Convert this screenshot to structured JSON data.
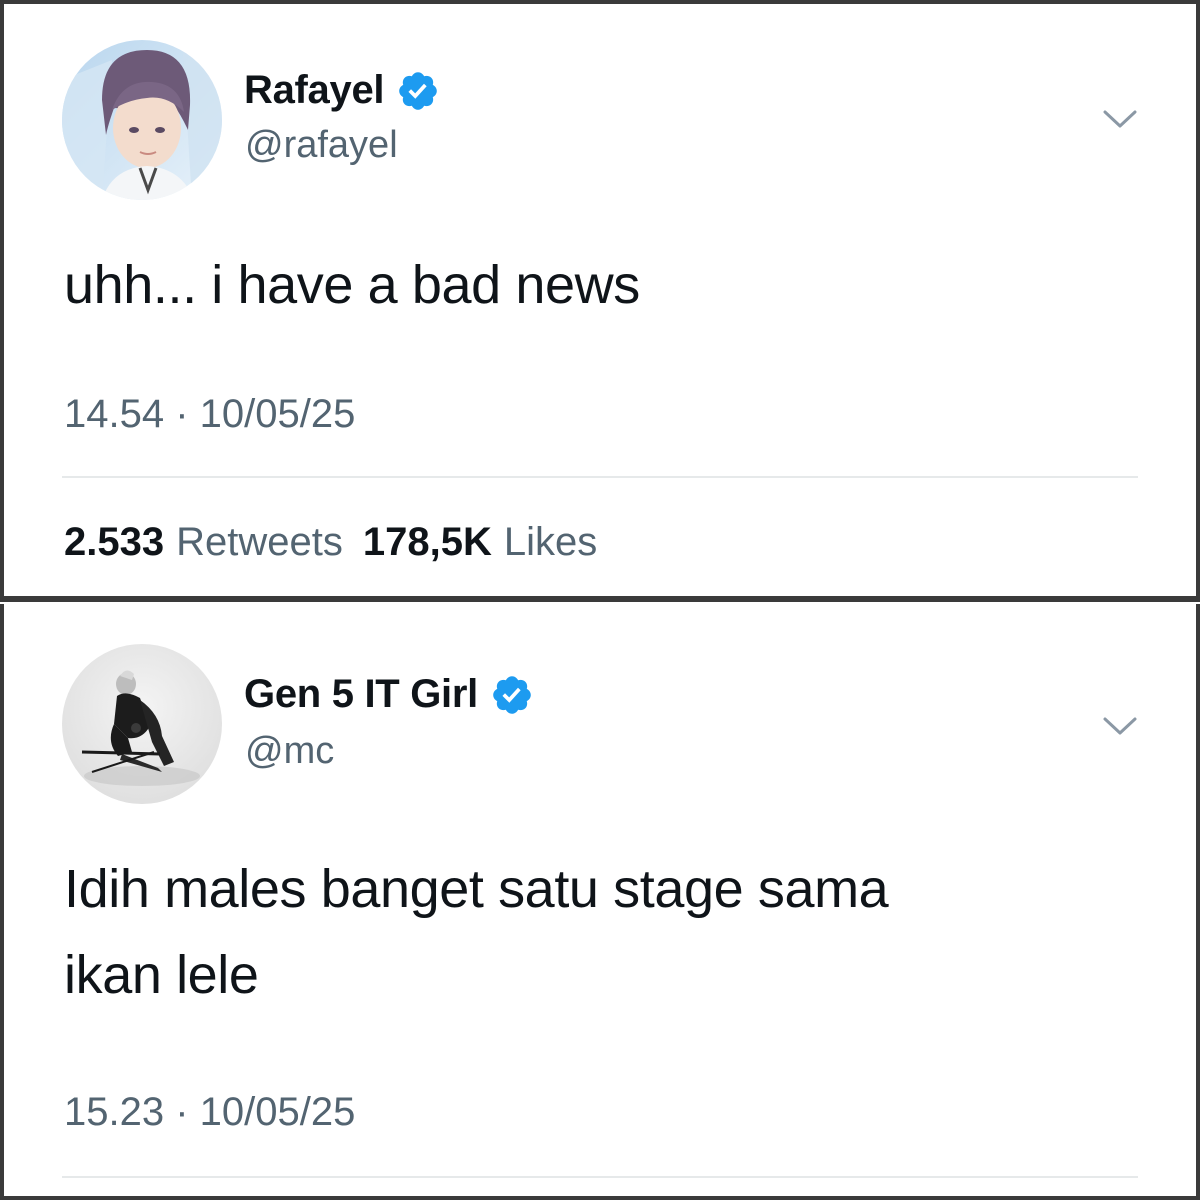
{
  "tweets": [
    {
      "display_name": "Rafayel",
      "handle": "@rafayel",
      "verified": true,
      "avatar_icon": "profile-photo-purple-haired-character",
      "text": "uhh... i have a bad news",
      "timestamp": "14.54 · 10/05/25",
      "retweets_count": "2.533",
      "retweets_label": "Retweets",
      "likes_count": "178,5K",
      "likes_label": "Likes"
    },
    {
      "display_name": "Gen 5 IT Girl",
      "handle": "@mc",
      "verified": true,
      "avatar_icon": "profile-photo-crouching-warrior-figure",
      "text_line1": "Idih males banget satu stage sama",
      "text_line2": "ikan lele",
      "timestamp": "15.23 · 10/05/25"
    }
  ],
  "colors": {
    "verified_blue": "#1d9bf0",
    "secondary_text": "#536471",
    "primary_text": "#0f1419",
    "frame_border": "#3a3a3a"
  }
}
